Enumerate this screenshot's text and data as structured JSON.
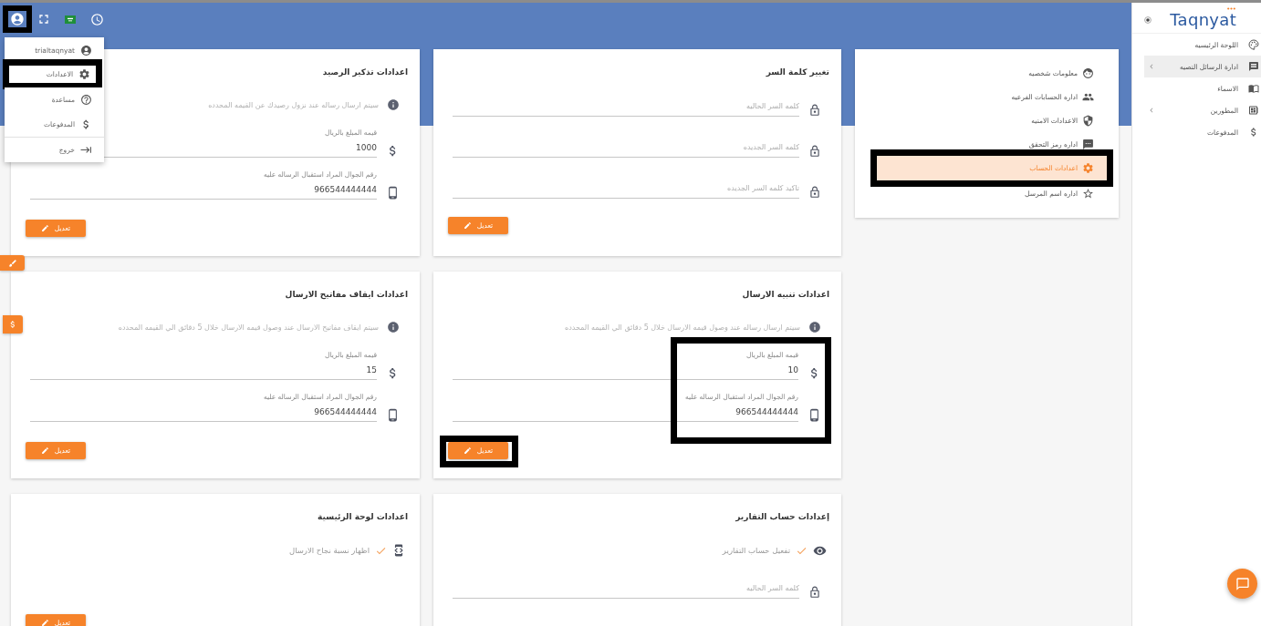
{
  "top_bar": {
    "buttons": [
      {
        "kind": "account",
        "framed": true
      },
      {
        "kind": "fullscreen",
        "framed": false
      },
      {
        "kind": "language",
        "framed": false
      },
      {
        "kind": "history",
        "framed": false
      }
    ]
  },
  "user_menu": {
    "items": [
      {
        "kind": "user",
        "label": "trialtaqnyat",
        "framed": false
      },
      {
        "kind": "settings",
        "label": "الاعدادات",
        "framed": true
      },
      {
        "kind": "help",
        "label": "مساعدة",
        "framed": false
      },
      {
        "kind": "payments",
        "label": "المدفوعات",
        "framed": false
      },
      {
        "kind": "logout",
        "label": "خروج",
        "framed": false
      }
    ]
  },
  "account_menu": {
    "items": [
      {
        "kind": "profile",
        "label": "معلومات شخصيه",
        "selected": false,
        "framed": false
      },
      {
        "kind": "subaccounts",
        "label": "اداره الحسابات الفرعيه",
        "selected": false,
        "framed": false
      },
      {
        "kind": "security",
        "label": "الاعدادات الامنيه",
        "selected": false,
        "framed": false
      },
      {
        "kind": "otp",
        "label": "اداره رمز التحقق",
        "selected": false,
        "framed": false
      },
      {
        "kind": "settings",
        "label": "اعدادات الحساب",
        "selected": true,
        "framed": true
      },
      {
        "kind": "sender",
        "label": "اداره اسم المرسل",
        "selected": false,
        "framed": false
      }
    ]
  },
  "card_columns": [
    {
      "cards": [
        {
          "title": "تغيير كلمة السر",
          "fields_framed": false,
          "rows": [
            {
              "kind": "password",
              "placeholder": "كلمه السر الحاليه"
            },
            {
              "kind": "password",
              "placeholder": "كلمه السر الجديده"
            },
            {
              "kind": "password",
              "placeholder": "تاكيد كلمه السر الجديده"
            }
          ],
          "button": {
            "label": "تعديل",
            "framed": false
          }
        },
        {
          "title": "اعدادات تنبيه الارسال",
          "fields_framed": true,
          "rows": [
            {
              "kind": "info",
              "text": "سيتم ارسال رساله عند وصول قيمه الارسال خلال 5 دقائق الي القيمه المحدده"
            },
            {
              "kind": "amount",
              "label": "قيمه المبلغ بالريال",
              "value": "10"
            },
            {
              "kind": "mobile",
              "label": "رقم الجوال المراد استقبال الرساله عليه",
              "value": "966544444444"
            }
          ],
          "button": {
            "label": "تعديل",
            "framed": true
          }
        },
        {
          "title": "إعدادات حساب التقارير",
          "fields_framed": false,
          "rows": [
            {
              "kind": "access",
              "label": "تفعيل حساب التقارير",
              "checked": true
            },
            {
              "kind": "password",
              "placeholder": "كلمه السر الحاليه"
            }
          ]
        }
      ]
    },
    {
      "cards": [
        {
          "title": "اعدادات تذكير الرصيد",
          "fields_framed": false,
          "rows": [
            {
              "kind": "info",
              "text": "سيتم ارسال رساله عند نزول رصيدك عن القيمه المحدده"
            },
            {
              "kind": "amount",
              "label": "قيمه المبلغ بالريال",
              "value": "1000"
            },
            {
              "kind": "mobile",
              "label": "رقم الجوال المراد استقبال الرساله عليه",
              "value": "966544444444"
            }
          ],
          "button": {
            "label": "تعديل",
            "framed": false
          }
        },
        {
          "title": "اعدادات ايقاف مفاتيح الارسال",
          "fields_framed": false,
          "rows": [
            {
              "kind": "info",
              "text": "سيتم ايقاف مفاتيح الارسال عند وصول قيمه الارسال خلال 5 دقائق الي القيمه المحدده"
            },
            {
              "kind": "amount",
              "label": "قيمه المبلغ بالريال",
              "value": "15"
            },
            {
              "kind": "mobile",
              "label": "رقم الجوال المراد استقبال الرساله عليه",
              "value": "966544444444"
            }
          ],
          "button": {
            "label": "تعديل",
            "framed": false
          }
        },
        {
          "title": "اعدادات لوحة الرئيسية",
          "fields_framed": false,
          "rows": [
            {
              "kind": "widget",
              "label": "اظهار نسبة نجاح الارسال",
              "checked": true
            }
          ],
          "button": {
            "label": "تعديل",
            "framed": false
          }
        }
      ]
    }
  ],
  "sidebar": {
    "logo": "Taqnyat",
    "items": [
      {
        "kind": "dashboard",
        "label": "اللوحة الرئيسيه",
        "selected": false,
        "expandable": false
      },
      {
        "kind": "messages",
        "label": "ادارة الرسائل النصيه",
        "selected": true,
        "expandable": true
      },
      {
        "kind": "names",
        "label": "الاسماء",
        "selected": false,
        "expandable": false
      },
      {
        "kind": "developers",
        "label": "المطورين",
        "selected": false,
        "expandable": true
      },
      {
        "kind": "payments",
        "label": "المدفوعات",
        "selected": false,
        "expandable": false
      }
    ]
  }
}
